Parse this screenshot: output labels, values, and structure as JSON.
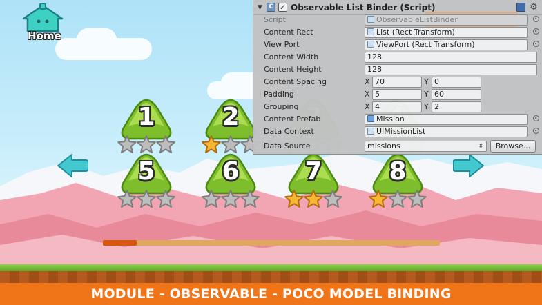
{
  "home": {
    "label": "Home"
  },
  "footer": {
    "caption": "MODULE - OBSERVABLE - POCO MODEL BINDING"
  },
  "missions": [
    {
      "number": "1",
      "stars": 0
    },
    {
      "number": "2",
      "stars": 1
    },
    {
      "number": "3",
      "stars": 0
    },
    {
      "number": "4",
      "stars": 0
    },
    {
      "number": "5",
      "stars": 0
    },
    {
      "number": "6",
      "stars": 0
    },
    {
      "number": "7",
      "stars": 2
    },
    {
      "number": "8",
      "stars": 1
    }
  ],
  "progress": {
    "fraction": 0.1
  },
  "inspector": {
    "component_title": "Observable List Binder (Script)",
    "enabled_mark": "✓",
    "icon_letter": "C",
    "overlay_number": "0",
    "fields": {
      "script": {
        "label": "Script",
        "value": "ObservableListBinder"
      },
      "content_rect": {
        "label": "Content Rect",
        "value": "List (Rect Transform)"
      },
      "view_port": {
        "label": "View Port",
        "value": "ViewPort (Rect Transform)"
      },
      "content_width": {
        "label": "Content Width",
        "value": "128"
      },
      "content_height": {
        "label": "Content Height",
        "value": "128"
      },
      "content_spacing": {
        "label": "Content Spacing",
        "x": "70",
        "y": "0"
      },
      "padding": {
        "label": "Padding",
        "x": "5",
        "y": "60"
      },
      "grouping": {
        "label": "Grouping",
        "x": "4",
        "y": "2"
      },
      "content_prefab": {
        "label": "Content Prefab",
        "value": "Mission"
      },
      "data_context": {
        "label": "Data Context",
        "value": "UIMissionList"
      },
      "data_source": {
        "label": "Data Source",
        "value": "missions",
        "browse_label": "Browse..."
      }
    },
    "axis_x": "X",
    "axis_y": "Y"
  },
  "colors": {
    "tile_green": "#8cc63f",
    "star_gold": "#f7b733",
    "star_gray": "#bdbdbd",
    "footer_orange": "#f07418",
    "progress_fill": "#d9570f",
    "progress_track": "#e0a75e"
  }
}
